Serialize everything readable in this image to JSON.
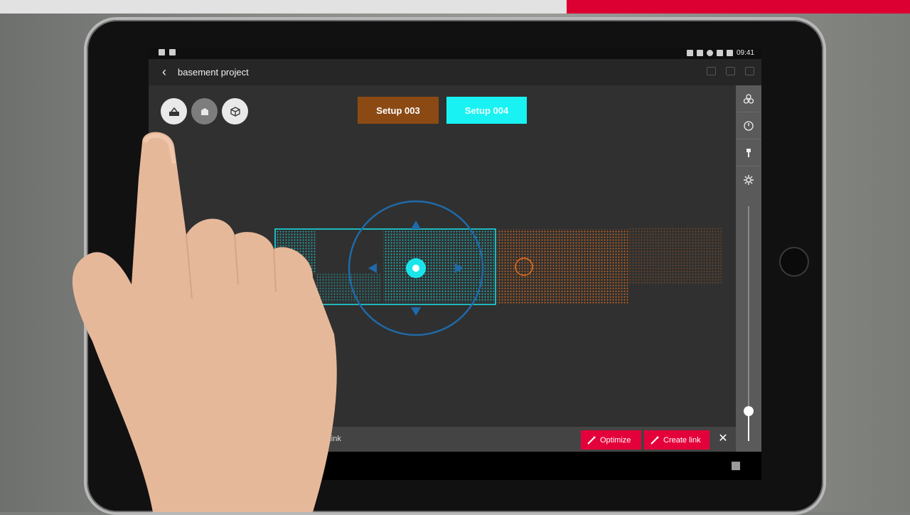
{
  "app": {
    "title": "basement project",
    "status_time": "09:41"
  },
  "toolbar": {
    "buttons": [
      {
        "name": "scanner-view",
        "icon": "scanner-icon"
      },
      {
        "name": "plan-view",
        "icon": "floorplan-icon"
      },
      {
        "name": "3d-view",
        "icon": "cube-icon"
      }
    ]
  },
  "setups": {
    "setup_a": {
      "label": "Setup 003",
      "color": "#8b4a14"
    },
    "setup_b": {
      "label": "Setup 004",
      "color": "#19f2f2"
    }
  },
  "bottom": {
    "hint": "e a link",
    "optimize_label": "Optimize",
    "create_link_label": "Create link",
    "close_label": "✕"
  },
  "right_panel": {
    "icons": [
      "layers-icon",
      "compass-icon",
      "marker-icon",
      "gear-icon"
    ],
    "slider_level": 0.12
  },
  "colors": {
    "accent_red": "#e4003a",
    "cyan": "#19f2f2",
    "orange": "#e8701c",
    "brand_bar": "#dc0032"
  }
}
